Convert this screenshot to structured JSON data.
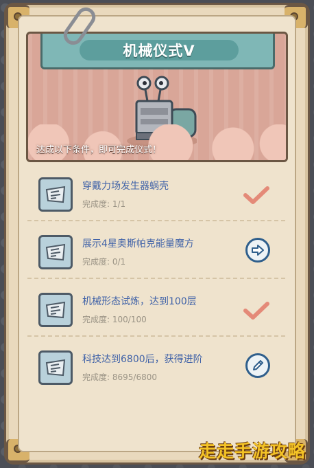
{
  "banner": {
    "title": "机械仪式V",
    "condition_note": "达成以下条件，即可完成仪式！"
  },
  "tasks": [
    {
      "name": "穿戴力场发生器蜗壳",
      "progress_label": "完成度:",
      "progress_value": "1/1",
      "status": "completed",
      "status_icon": "check-icon"
    },
    {
      "name": "展示4星奥斯帕克能量魔方",
      "progress_label": "完成度:",
      "progress_value": "0/1",
      "status": "go",
      "status_icon": "arrow-right-icon"
    },
    {
      "name": "机械形态试炼，达到100层",
      "progress_label": "完成度:",
      "progress_value": "100/100",
      "status": "completed",
      "status_icon": "check-icon"
    },
    {
      "name": "科技达到6800后，获得进阶",
      "progress_label": "完成度:",
      "progress_value": "8695/6800",
      "status": "edit",
      "status_icon": "pencil-icon"
    }
  ],
  "watermark": "走走手游攻略",
  "colors": {
    "frame": "#e9d9bd",
    "title_plate": "#7fb7b6",
    "task_text": "#4163a8",
    "check": "#e48a78",
    "button_border": "#2f5f8c"
  }
}
